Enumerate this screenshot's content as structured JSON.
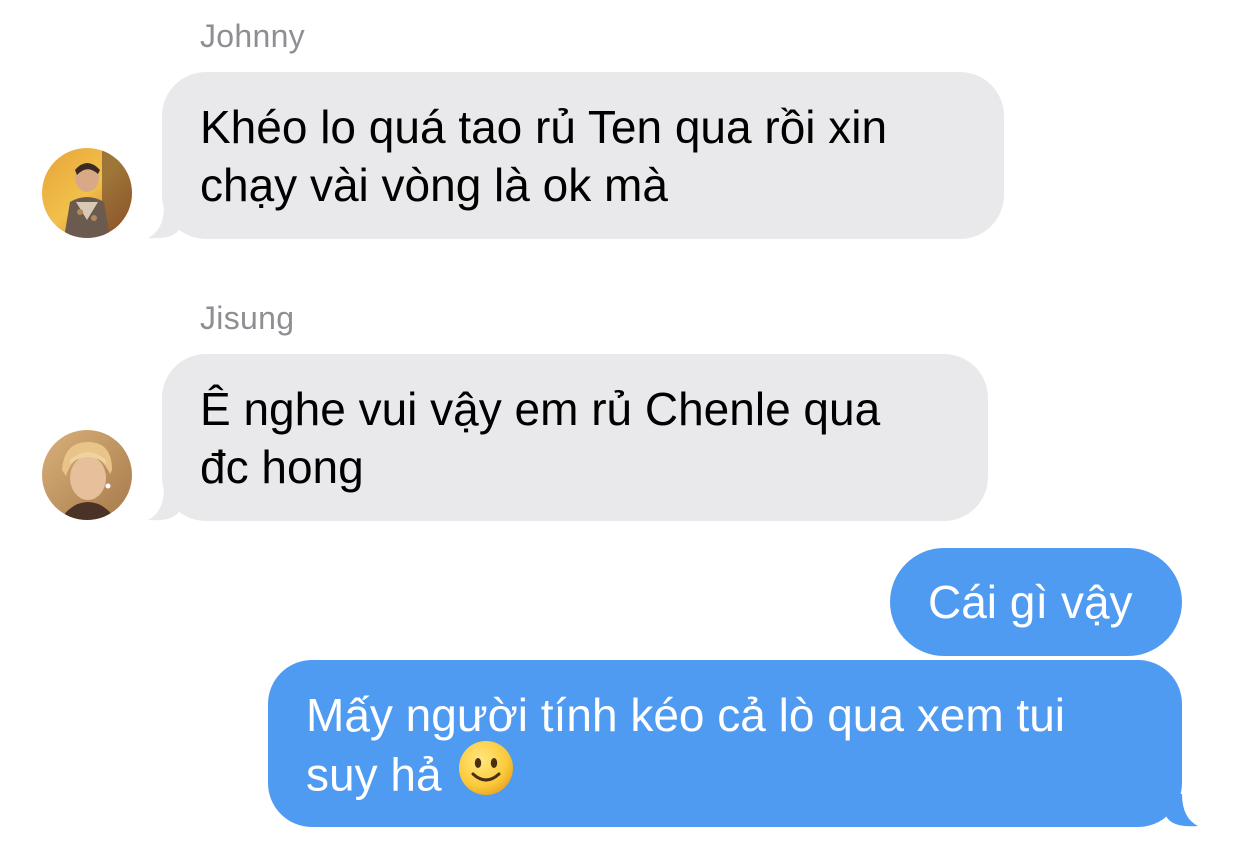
{
  "conversation": {
    "messages": [
      {
        "sender": "Johnny",
        "direction": "incoming",
        "avatar_icon": "johnny-avatar",
        "text": "Khéo lo quá tao rủ Ten qua rồi xin\nchạy vài vòng là ok mà"
      },
      {
        "sender": "Jisung",
        "direction": "incoming",
        "avatar_icon": "jisung-avatar",
        "text": "Ê nghe vui vậy em rủ Chenle qua\nđc hong"
      },
      {
        "sender": "",
        "direction": "outgoing",
        "text": "Cái gì vậy"
      },
      {
        "sender": "",
        "direction": "outgoing",
        "text": "Mấy người tính kéo cả lò qua xem tui\nsuy hả",
        "emoji": "slightly-smiling-face-icon"
      }
    ]
  },
  "colors": {
    "incoming_bubble": "#e9e9eb",
    "outgoing_bubble": "#4f9bf2",
    "sender_name": "#8e8e93",
    "background": "#ffffff"
  }
}
